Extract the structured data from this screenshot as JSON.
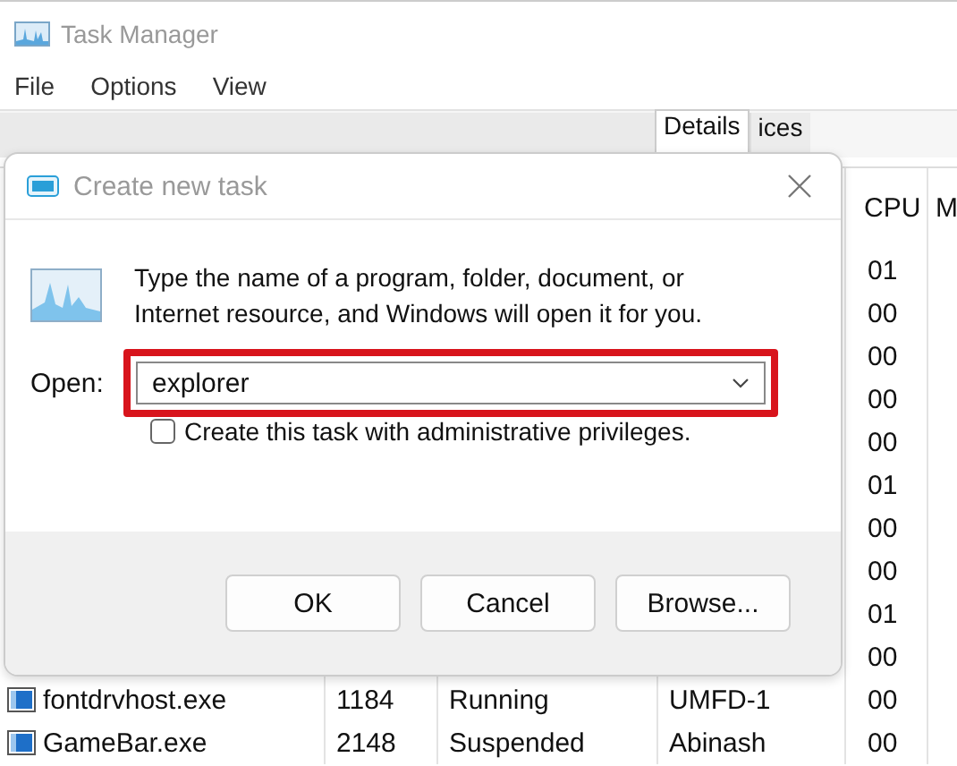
{
  "window": {
    "title": "Task Manager"
  },
  "menu": [
    "File",
    "Options",
    "View"
  ],
  "tabs": [
    {
      "label": "Details",
      "selected": true
    },
    {
      "label": "ices",
      "selected": false
    }
  ],
  "table": {
    "columns": [
      "CPU",
      "M"
    ],
    "rows": [
      {
        "cpu": "01"
      },
      {
        "cpu": "00"
      },
      {
        "cpu": "00"
      },
      {
        "cpu": "00"
      },
      {
        "cpu": "00"
      },
      {
        "cpu": "01"
      },
      {
        "cpu": "00"
      },
      {
        "cpu": "00"
      },
      {
        "cpu": "01"
      },
      {
        "cpu": "00"
      },
      {
        "name": "fontdrvhost.exe",
        "pid": "1184",
        "status": "Running",
        "user": "UMFD-1",
        "cpu": "00"
      },
      {
        "name": "GameBar.exe",
        "pid": "2148",
        "status": "Suspended",
        "user": "Abinash",
        "cpu": "00"
      }
    ]
  },
  "dialog": {
    "title": "Create new task",
    "message": "Type the name of a program, folder, document, or Internet resource, and Windows will open it for you.",
    "open_label": "Open:",
    "open_value": "explorer",
    "highlighted": true,
    "admin_checkbox": {
      "label": "Create this task with administrative privileges.",
      "checked": false
    },
    "buttons": [
      "OK",
      "Cancel",
      "Browse..."
    ]
  }
}
